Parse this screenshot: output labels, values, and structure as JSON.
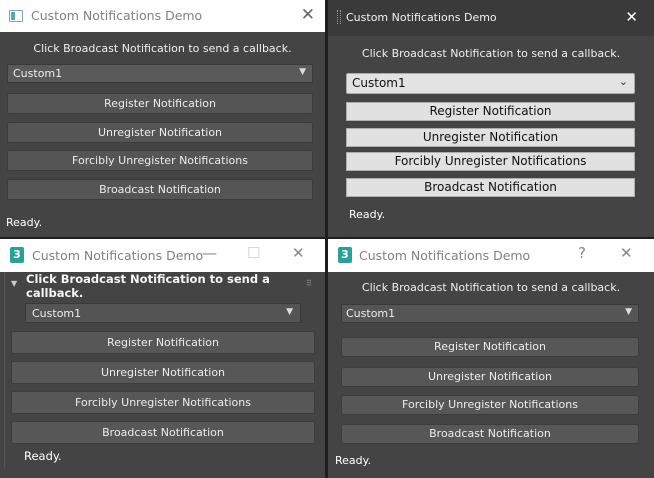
{
  "colors": {
    "accent": "#2aa198",
    "dark_bg": "#444444",
    "title_bar_light": "#ffffff",
    "title_bar_dark": "#3a3a3a"
  },
  "panels": [
    {
      "title": "Custom Notifications Demo",
      "icon": "window-app-icon",
      "prompt": "Click Broadcast Notification to send a callback.",
      "combo_value": "Custom1",
      "buttons": [
        "Register Notification",
        "Unregister Notification",
        "Forcibly Unregister Notifications",
        "Broadcast Notification"
      ],
      "status": "Ready."
    },
    {
      "title": "Custom Notifications Demo",
      "icon": "grip-icon",
      "prompt": "Click Broadcast Notification to send a callback.",
      "combo_value": "Custom1",
      "buttons": [
        "Register Notification",
        "Unregister Notification",
        "Forcibly Unregister Notifications",
        "Broadcast Notification"
      ],
      "status": "Ready."
    },
    {
      "title": "Custom Notifications Demo",
      "icon": "3dsmax-logo-icon",
      "prompt": "Click Broadcast Notification to send a callback.",
      "combo_value": "Custom1",
      "buttons": [
        "Register Notification",
        "Unregister Notification",
        "Forcibly Unregister Notifications",
        "Broadcast Notification"
      ],
      "status": "Ready."
    },
    {
      "title": "Custom Notifications Demo",
      "icon": "3dsmax-logo-icon",
      "prompt": "Click Broadcast Notification to send a callback.",
      "combo_value": "Custom1",
      "buttons": [
        "Register Notification",
        "Unregister Notification",
        "Forcibly Unregister Notifications",
        "Broadcast Notification"
      ],
      "status": "Ready."
    }
  ],
  "glyphs": {
    "close": "✕",
    "minimize": "—",
    "maximize": "☐",
    "help": "?",
    "dropdown": "▼",
    "chevron": "⌄",
    "collapse": "▼",
    "logo": "3"
  }
}
